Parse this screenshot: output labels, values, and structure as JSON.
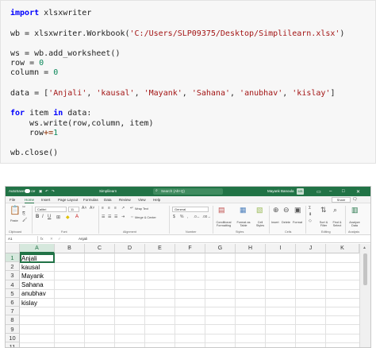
{
  "code": {
    "line1": {
      "kw": "import",
      "rest": " xlsxwriter"
    },
    "line2": {
      "pre": "wb = xlsxwriter.Workbook(",
      "str": "'C:/Users/SLP09375/Desktop/Simplilearn.xlsx'",
      "post": ")"
    },
    "line3": "ws = wb.add_worksheet()",
    "line4": {
      "pre": "row = ",
      "num": "0"
    },
    "line5": {
      "pre": "column = ",
      "num": "0"
    },
    "line6": {
      "pre": "data = [",
      "items": [
        "'Anjali'",
        "'kausal'",
        "'Mayank'",
        "'Sahana'",
        "'anubhav'",
        "'kislay'"
      ],
      "sep": ", ",
      "post": "]"
    },
    "line7": {
      "kw1": "for",
      "mid": " item ",
      "kw2": "in",
      "post": " data:"
    },
    "line8": "ws.write(row,column, item)",
    "line9": {
      "pre": "row",
      "op": "+=",
      "num": "1"
    },
    "line10": "wb.close()"
  },
  "excel": {
    "titlebar": {
      "autosave": "AutoSave",
      "toggle": "Off",
      "filename": "Simplilearn",
      "search_placeholder": "Search (Alt+Q)",
      "user_name": "Mayank Banoula",
      "user_initials": "MB",
      "minimize": "–",
      "restore": "□",
      "close": "✕"
    },
    "menu": [
      "File",
      "Home",
      "Insert",
      "Page Layout",
      "Formulas",
      "Data",
      "Review",
      "View",
      "Help"
    ],
    "menu_active": "Home",
    "share": "Share",
    "ribbon": {
      "paste": "Paste",
      "clipboard": "Clipboard",
      "font_name": "Calibri",
      "font_size": "11",
      "font": "Font",
      "wrap_text": "Wrap Text",
      "merge_center": "Merge & Center",
      "alignment": "Alignment",
      "number_format": "General",
      "number": "Number",
      "conditional_formatting": "Conditional Formatting",
      "format_as_table": "Format as Table",
      "cell_styles": "Cell Styles",
      "styles": "Styles",
      "insert": "Insert",
      "delete": "Delete",
      "format": "Format",
      "cells": "Cells",
      "sort_filter": "Sort & Filter",
      "find_select": "Find & Select",
      "editing": "Editing",
      "analyze_data": "Analyze Data",
      "analysis": "Analysis"
    },
    "formula_bar": {
      "name_box": "A1",
      "fx": "fx",
      "value": "Anjali"
    },
    "columns": [
      "A",
      "B",
      "C",
      "D",
      "E",
      "F",
      "G",
      "H",
      "I",
      "J",
      "K"
    ],
    "rows": [
      "1",
      "2",
      "3",
      "4",
      "5",
      "6",
      "7",
      "8",
      "9",
      "10",
      "11"
    ],
    "cells_a": [
      "Anjali",
      "kausal",
      "Mayank",
      "Sahana",
      "anubhav",
      "kislay"
    ],
    "colors": {
      "accent": "#217346",
      "selection": "#d6e8dd"
    }
  }
}
